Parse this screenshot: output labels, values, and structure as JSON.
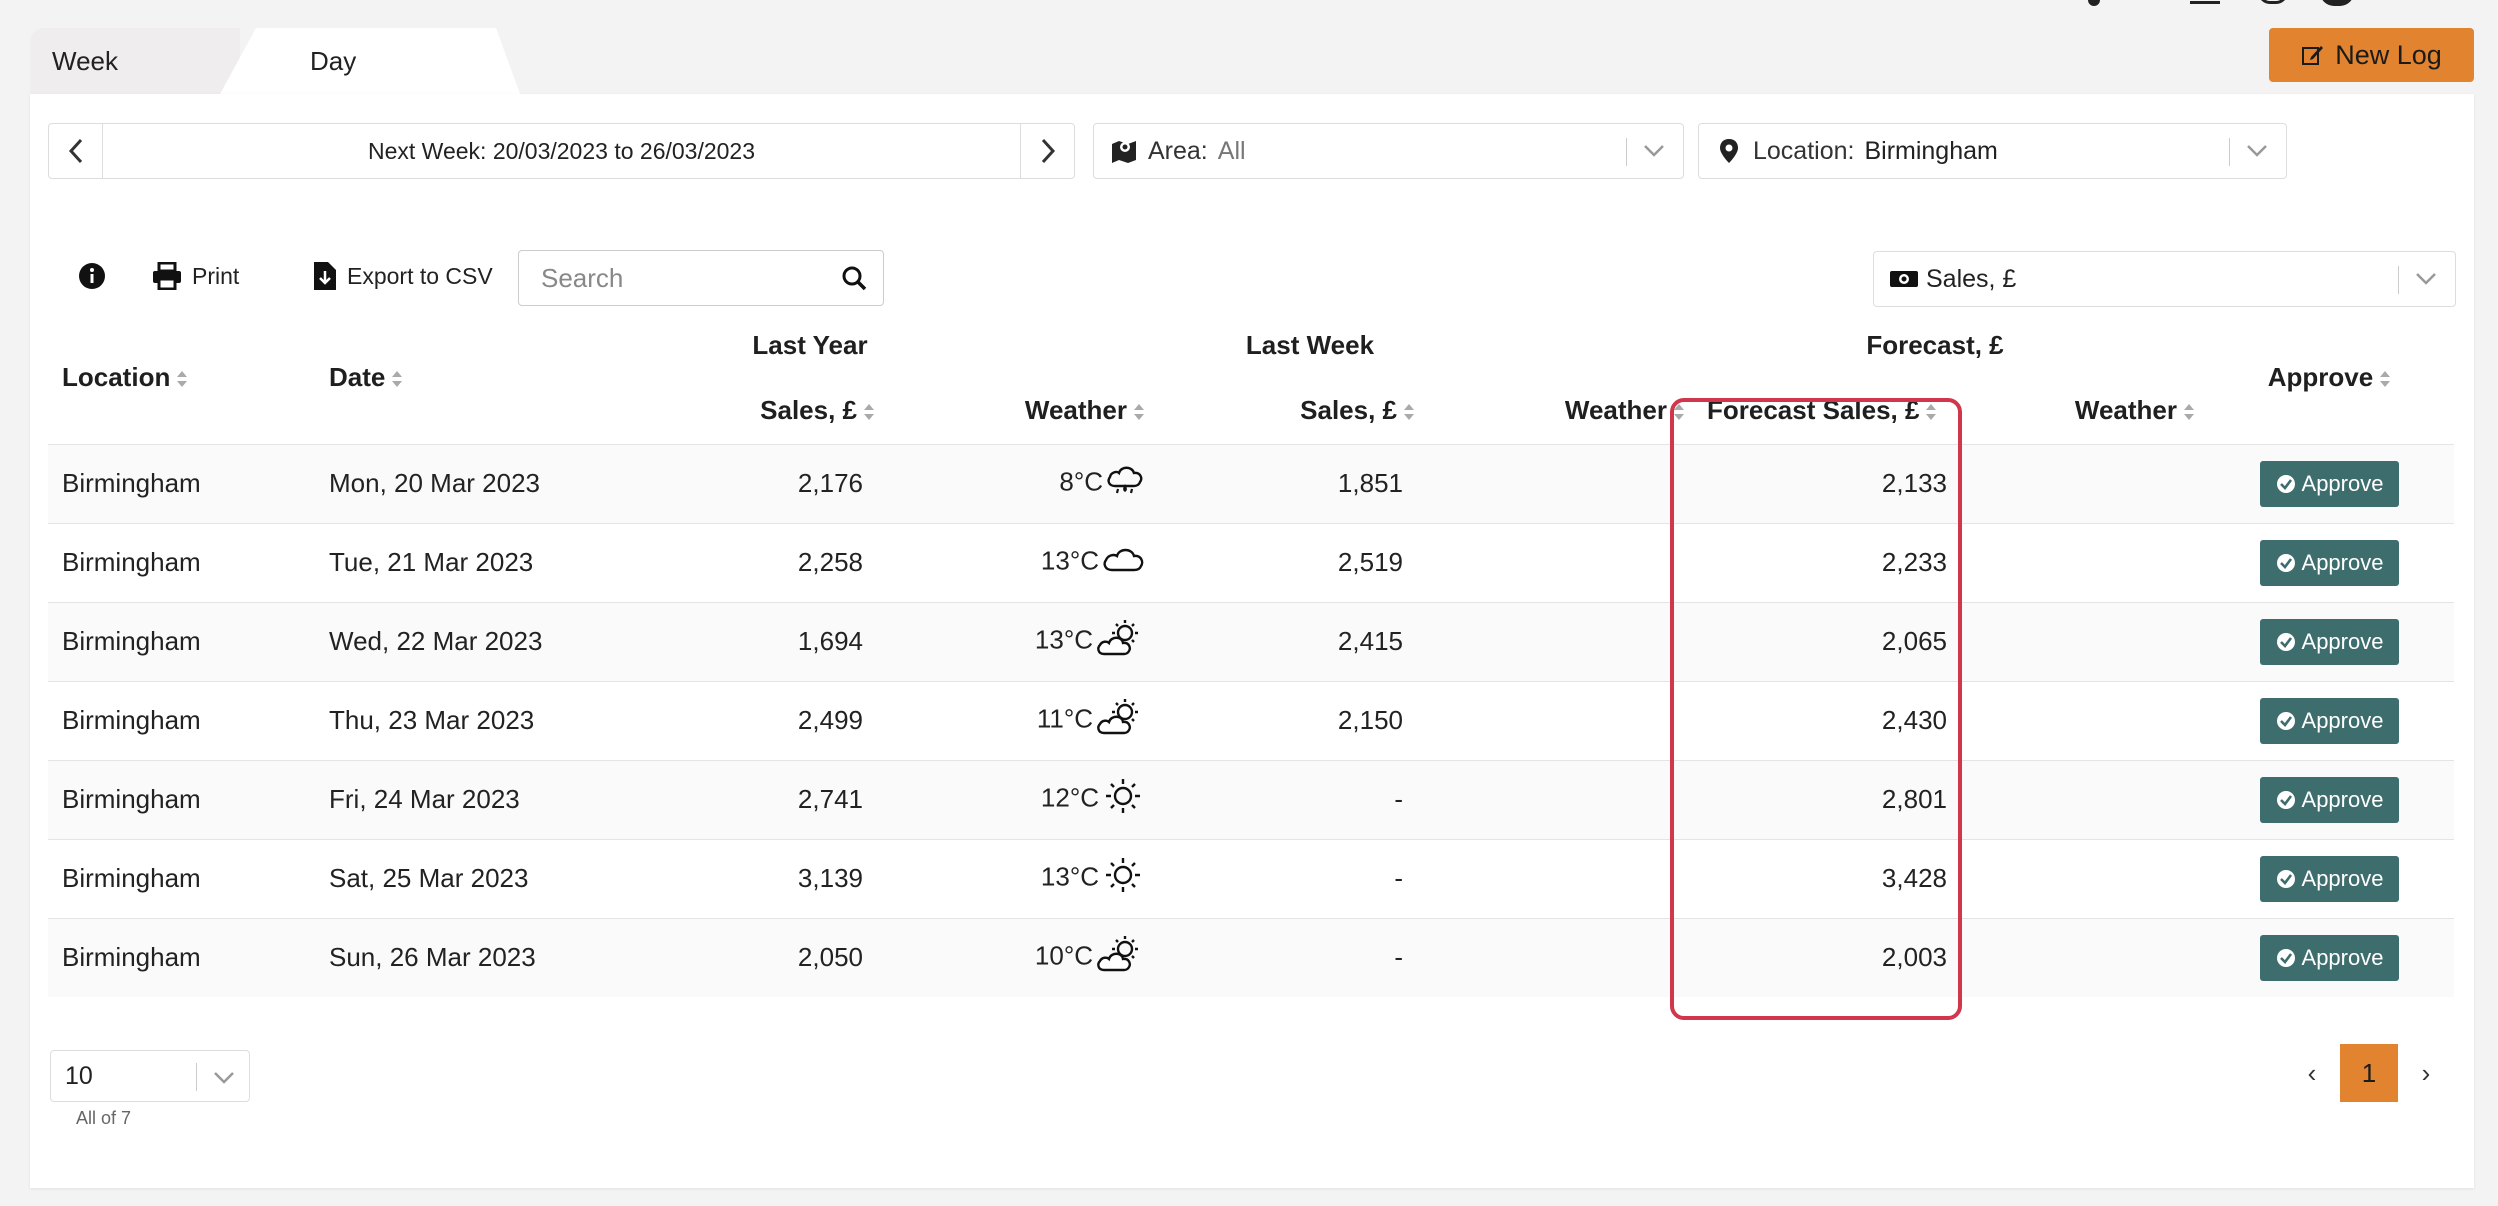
{
  "tabs": {
    "week": "Week",
    "day": "Day"
  },
  "header": {
    "new_log": "New Log"
  },
  "week_nav": {
    "range": "Next Week: 20/03/2023 to 26/03/2023"
  },
  "area": {
    "label": "Area:",
    "value": "All"
  },
  "location": {
    "label": "Location:",
    "value": "Birmingham"
  },
  "toolbar": {
    "print": "Print",
    "export": "Export to CSV",
    "search_placeholder": "Search"
  },
  "metric_select": {
    "value": "Sales, £"
  },
  "table": {
    "group_headers": {
      "last_year": "Last Year",
      "last_week": "Last Week",
      "forecast": "Forecast, £"
    },
    "columns": {
      "location": "Location",
      "date": "Date",
      "ly_sales": "Sales, £",
      "ly_weather": "Weather",
      "lw_sales": "Sales, £",
      "lw_weather": "Weather",
      "fc_sales": "Forecast Sales, £",
      "fc_weather": "Weather",
      "approve": "Approve"
    },
    "rows": [
      {
        "location": "Birmingham",
        "date": "Mon, 20 Mar 2023",
        "ly_sales": "2,176",
        "ly_weather": "8°C",
        "ly_icon": "rain-cloud-icon",
        "lw_sales": "1,851",
        "fc_sales": "2,133",
        "approve": "Approve"
      },
      {
        "location": "Birmingham",
        "date": "Tue, 21 Mar 2023",
        "ly_sales": "2,258",
        "ly_weather": "13°C",
        "ly_icon": "cloud-icon",
        "lw_sales": "2,519",
        "fc_sales": "2,233",
        "approve": "Approve"
      },
      {
        "location": "Birmingham",
        "date": "Wed, 22 Mar 2023",
        "ly_sales": "1,694",
        "ly_weather": "13°C",
        "ly_icon": "partly-cloudy-icon",
        "lw_sales": "2,415",
        "fc_sales": "2,065",
        "approve": "Approve"
      },
      {
        "location": "Birmingham",
        "date": "Thu, 23 Mar 2023",
        "ly_sales": "2,499",
        "ly_weather": "11°C",
        "ly_icon": "partly-cloudy-icon",
        "lw_sales": "2,150",
        "fc_sales": "2,430",
        "approve": "Approve"
      },
      {
        "location": "Birmingham",
        "date": "Fri, 24 Mar 2023",
        "ly_sales": "2,741",
        "ly_weather": "12°C",
        "ly_icon": "sun-icon",
        "lw_sales": "-",
        "fc_sales": "2,801",
        "approve": "Approve"
      },
      {
        "location": "Birmingham",
        "date": "Sat, 25 Mar 2023",
        "ly_sales": "3,139",
        "ly_weather": "13°C",
        "ly_icon": "sun-icon",
        "lw_sales": "-",
        "fc_sales": "3,428",
        "approve": "Approve"
      },
      {
        "location": "Birmingham",
        "date": "Sun, 26 Mar 2023",
        "ly_sales": "2,050",
        "ly_weather": "10°C",
        "ly_icon": "partly-cloudy-icon",
        "lw_sales": "-",
        "fc_sales": "2,003",
        "approve": "Approve"
      }
    ]
  },
  "pagination": {
    "page_size": "10",
    "summary": "All of 7",
    "current_page": "1",
    "prev": "‹",
    "next": "›"
  },
  "colors": {
    "accent": "#e2832f",
    "approve": "#3e6d6e",
    "highlight": "#d0364c"
  }
}
